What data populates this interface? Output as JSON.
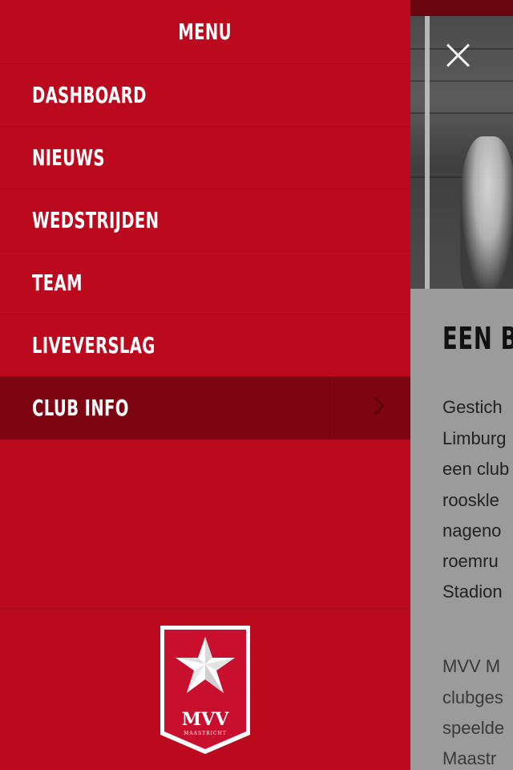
{
  "drawer": {
    "title": "MENU",
    "items": [
      {
        "label": "DASHBOARD",
        "active": false
      },
      {
        "label": "NIEUWS",
        "active": false
      },
      {
        "label": "WEDSTRIJDEN",
        "active": false
      },
      {
        "label": "TEAM",
        "active": false
      },
      {
        "label": "LIVEVERSLAG",
        "active": false
      },
      {
        "label": "CLUB INFO",
        "active": true
      }
    ],
    "logo": {
      "name": "MVV",
      "subtitle": "MAASTRICHT"
    }
  },
  "background": {
    "heading": "EEN B",
    "paragraph1": [
      "Gestich",
      "Limburg",
      "een club",
      "rooskle",
      "nageno",
      "roemru",
      "Stadion"
    ],
    "paragraph2": [
      "MVV M",
      "clubges",
      "speelde",
      "Maastr"
    ]
  },
  "colors": {
    "drawer": "#bb0a1e",
    "active_item": "#7d0512",
    "text": "#ffffff"
  },
  "icons": {
    "close": "close-icon",
    "chevron": "chevron-right-icon",
    "logo": "mvv-logo-icon"
  }
}
